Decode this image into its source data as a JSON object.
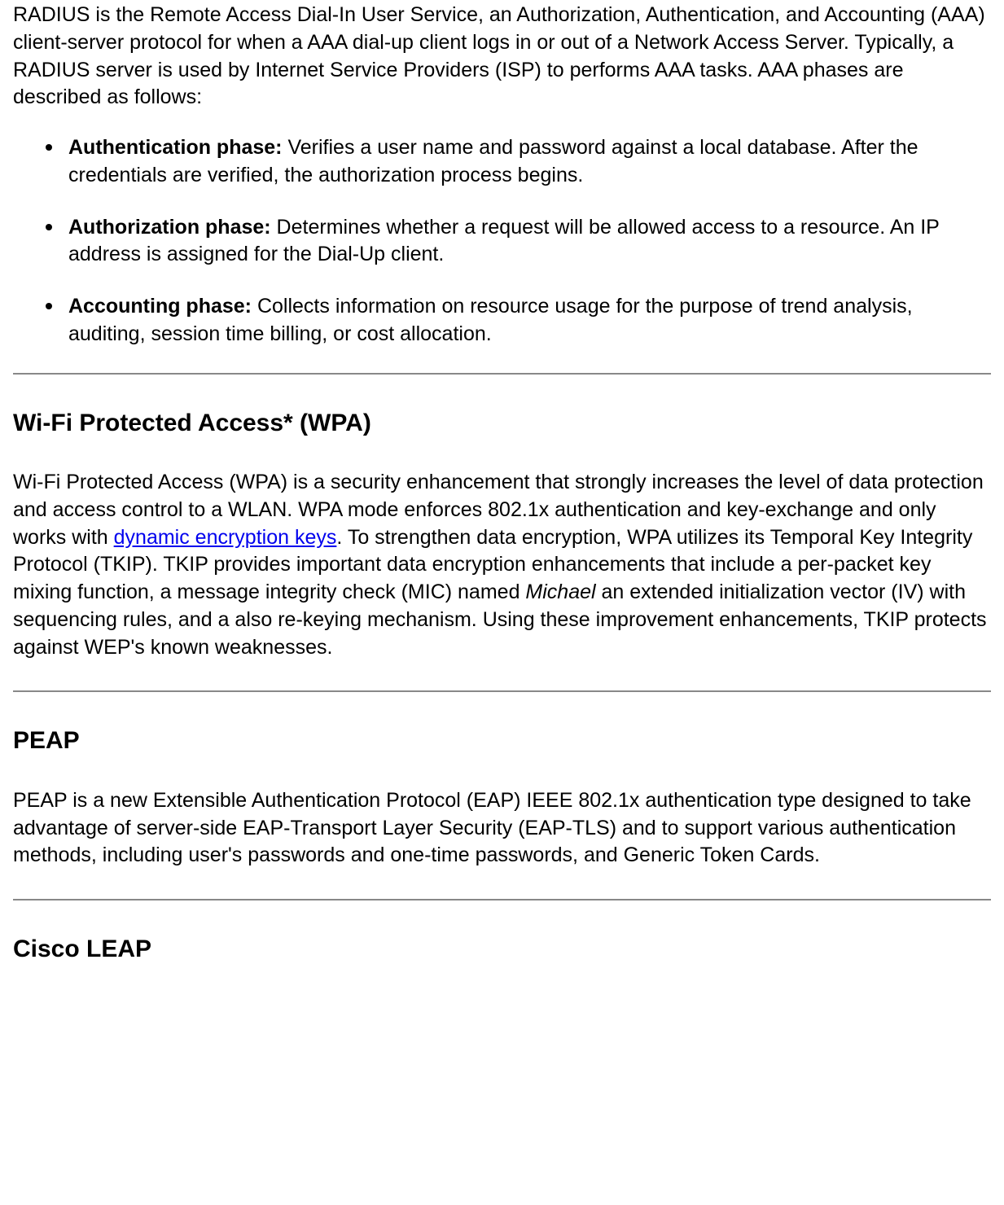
{
  "intro": "RADIUS is the Remote Access Dial-In User Service, an Authorization, Authentication, and Accounting (AAA) client-server protocol for when a AAA dial-up client logs in or out of a Network Access Server. Typically, a RADIUS server is used by Internet Service Providers (ISP) to performs AAA tasks. AAA phases are described as follows:",
  "phases": [
    {
      "label": "Authentication phase:",
      "text": " Verifies a user name and password against a local database. After the credentials are verified, the authorization process begins."
    },
    {
      "label": "Authorization phase:",
      "text": " Determines whether a request will be allowed access to a resource. An IP address is assigned for the Dial-Up client."
    },
    {
      "label": "Accounting phase:",
      "text": " Collects information on resource usage for the purpose of trend analysis, auditing, session time billing, or cost allocation."
    }
  ],
  "sections": {
    "wpa": {
      "heading": "Wi-Fi Protected Access* (WPA)",
      "para_before_link": "Wi-Fi Protected Access (WPA) is a security enhancement that strongly increases the level of data protection and access control to a WLAN. WPA mode enforces 802.1x authentication and key-exchange and only works with ",
      "link_text": "dynamic encryption keys",
      "para_after_link_before_italic": ". To strengthen data encryption, WPA utilizes its Temporal Key Integrity Protocol (TKIP). TKIP provides important data encryption enhancements that include a per-packet key mixing function, a message integrity check (MIC) named ",
      "italic_text": "Michael",
      "para_after_italic": " an extended initialization vector (IV) with sequencing rules, and a also re-keying mechanism. Using these improvement enhancements, TKIP protects against WEP's known weaknesses."
    },
    "peap": {
      "heading": "PEAP",
      "para": "PEAP is a new Extensible Authentication Protocol (EAP) IEEE 802.1x authentication type designed to take advantage of server-side EAP-Transport Layer Security (EAP-TLS) and to support various authentication methods, including user's passwords and one-time passwords, and Generic Token Cards."
    },
    "leap": {
      "heading": "Cisco LEAP"
    }
  }
}
